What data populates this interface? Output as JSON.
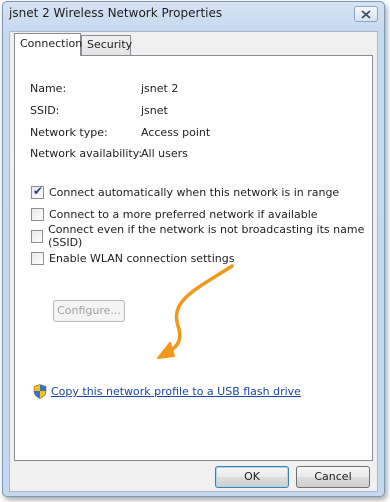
{
  "window": {
    "title": "jsnet 2 Wireless Network Properties"
  },
  "tabs": [
    {
      "label": "Connection",
      "active": true
    },
    {
      "label": "Security",
      "active": false
    }
  ],
  "properties": [
    {
      "label": "Name:",
      "value": "jsnet 2"
    },
    {
      "label": "SSID:",
      "value": "jsnet"
    },
    {
      "label": "Network type:",
      "value": "Access point"
    },
    {
      "label": "Network availability:",
      "value": "All users"
    }
  ],
  "checkboxes": [
    {
      "label": "Connect automatically when this network is in range",
      "checked": true
    },
    {
      "label": "Connect to a more preferred network if available",
      "checked": false
    },
    {
      "label": "Connect even if the network is not broadcasting its name (SSID)",
      "checked": false
    },
    {
      "label": "Enable WLAN connection settings",
      "checked": false
    }
  ],
  "configure_button": {
    "label": "Configure...",
    "enabled": false
  },
  "usb_link": {
    "label": "Copy this network profile to a USB flash drive",
    "icon": "shield-icon"
  },
  "buttons": {
    "ok": "OK",
    "cancel": "Cancel"
  },
  "colors": {
    "link": "#1c47a8",
    "annotation_arrow": "#f0971c",
    "title_bar": "#c7d9ef"
  }
}
